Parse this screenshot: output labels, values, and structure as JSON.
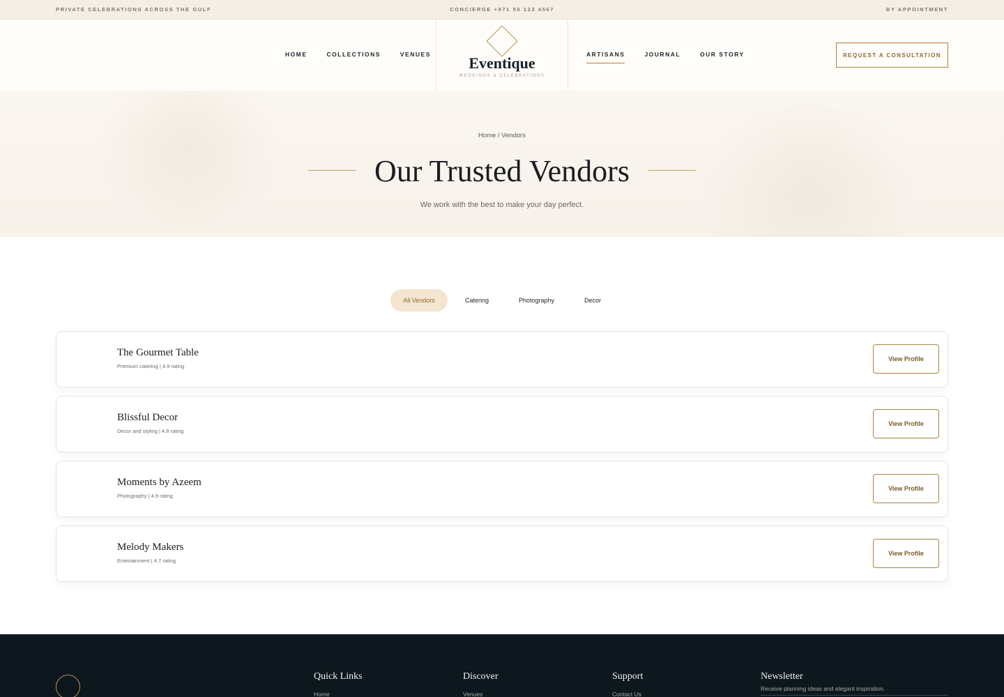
{
  "topbar": {
    "left": "PRIVATE CELEBRATIONS ACROSS THE GULF",
    "center": "CONCIERGE +971 50 123 4567",
    "right": "BY APPOINTMENT"
  },
  "nav": {
    "left": [
      "HOME",
      "COLLECTIONS",
      "VENUES"
    ],
    "right": [
      "ARTISANS",
      "JOURNAL",
      "OUR STORY"
    ],
    "active": "ARTISANS"
  },
  "logo": {
    "name": "Eventique",
    "tagline": "WEDDINGS & CELEBRATIONS"
  },
  "cta_label": "REQUEST A CONSULTATION",
  "hero": {
    "breadcrumb_home": "Home",
    "breadcrumb_separator": " / ",
    "breadcrumb_current": "Vendors",
    "title": "Our Trusted Vendors",
    "subtitle": "We work with the best to make your day perfect."
  },
  "filters": [
    "All Vendors",
    "Catering",
    "Photography",
    "Decor"
  ],
  "active_filter": "All Vendors",
  "vendors": [
    {
      "name": "The Gourmet Table",
      "meta": "Premium catering | 4.9 rating",
      "button": "View Profile"
    },
    {
      "name": "Blissful Decor",
      "meta": "Decor and styling | 4.8 rating",
      "button": "View Profile"
    },
    {
      "name": "Moments by Azeem",
      "meta": "Photography | 4.9 rating",
      "button": "View Profile"
    },
    {
      "name": "Melody Makers",
      "meta": "Entertainment | 4.7 rating",
      "button": "View Profile"
    }
  ],
  "footer": {
    "columns": [
      {
        "title": "Quick Links",
        "first_link": "Home"
      },
      {
        "title": "Discover",
        "first_link": "Venues"
      },
      {
        "title": "Support",
        "first_link": "Contact Us"
      }
    ],
    "newsletter": {
      "title": "Newsletter",
      "text": "Receive planning ideas and elegant inspiration."
    }
  },
  "colors": {
    "accent": "#a9823e",
    "topbar_bg": "#f5eee4",
    "active_chip_bg": "#f3e5cf",
    "footer_bg": "#0c181e"
  }
}
